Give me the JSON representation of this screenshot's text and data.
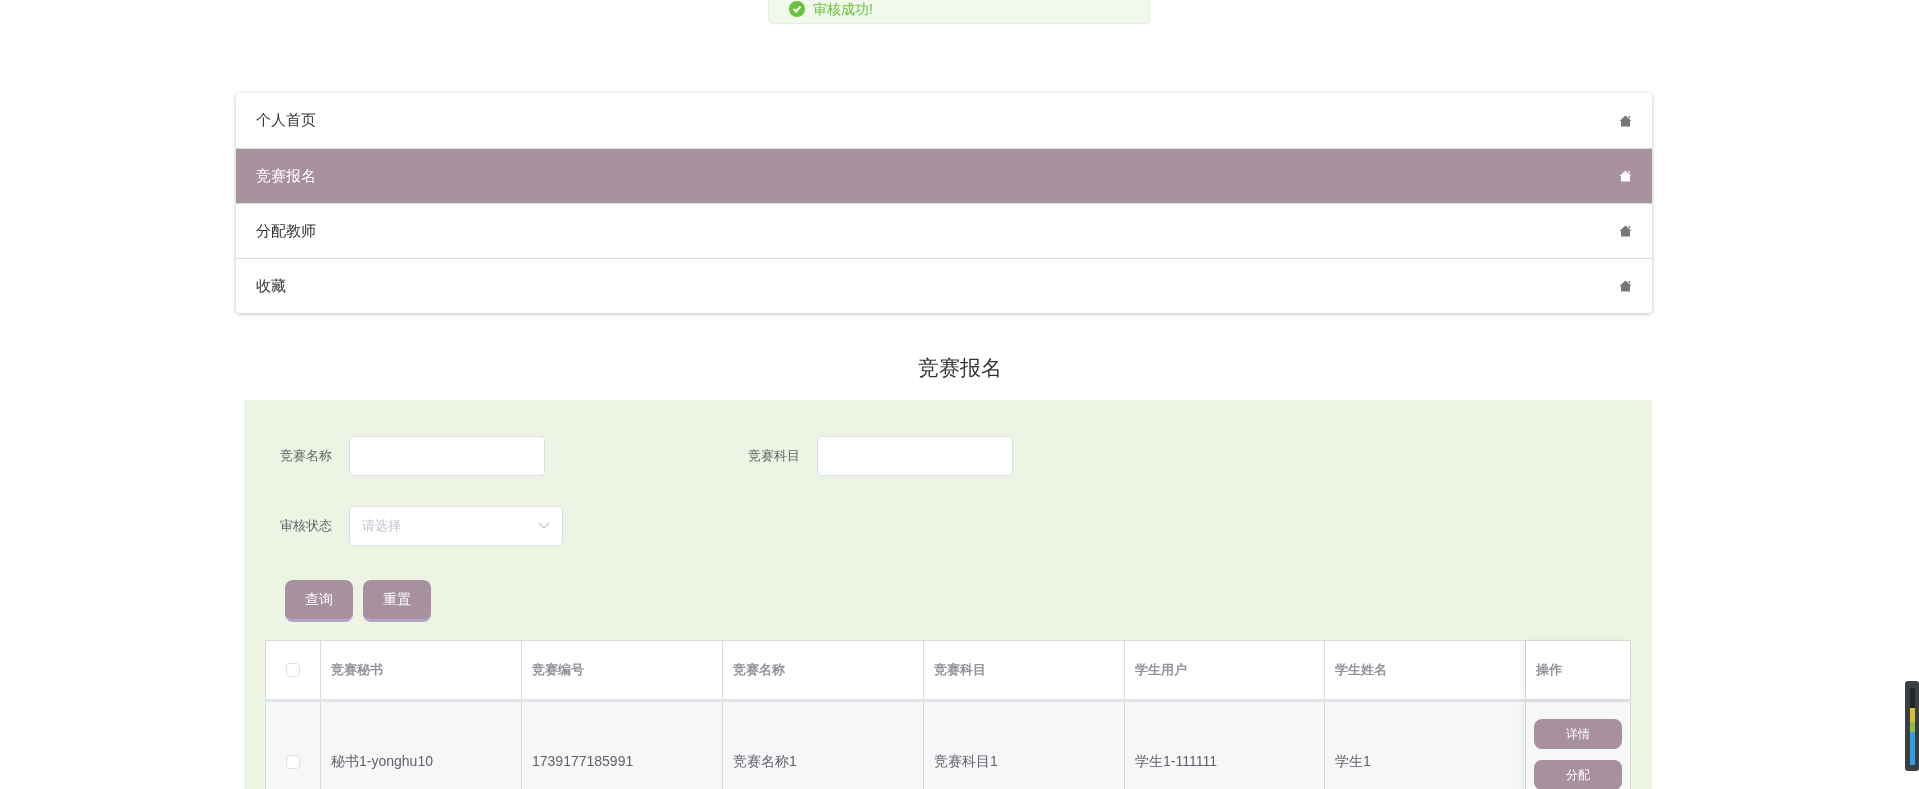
{
  "toast": {
    "message": "审核成功!"
  },
  "menu": [
    {
      "label": "个人首页",
      "selected": false
    },
    {
      "label": "竞赛报名",
      "selected": true
    },
    {
      "label": "分配教师",
      "selected": false
    },
    {
      "label": "收藏",
      "selected": false
    }
  ],
  "page_title": "竞赛报名",
  "filters": [
    {
      "label": "竞赛名称",
      "kind": "input"
    },
    {
      "label": "竞赛科目",
      "kind": "input"
    },
    {
      "label": "审核状态",
      "kind": "select",
      "placeholder": "请选择"
    }
  ],
  "buttons": [
    "查询",
    "重置"
  ],
  "table": {
    "select_all": false,
    "columns": [
      "竞赛秘书",
      "竞赛编号",
      "竞赛名称",
      "竞赛科目",
      "学生用户",
      "学生姓名",
      "操作"
    ],
    "rows": [
      {
        "checked": false,
        "cells": [
          "秘书1-yonghu10",
          "1739177185991",
          "竞赛名称1",
          "竞赛科目1",
          "学生1-111111",
          "学生1"
        ],
        "actions": [
          "详情",
          "分配"
        ]
      }
    ]
  }
}
